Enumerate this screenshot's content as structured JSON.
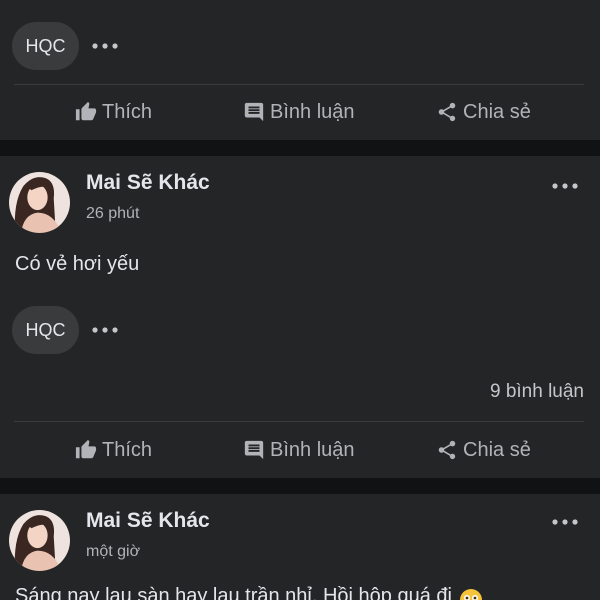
{
  "theme": {
    "page_bg": "#111214",
    "card_bg": "#242526",
    "text_primary": "#e4e6eb",
    "text_secondary": "#b0b3b8",
    "divider": "#3a3b3c",
    "badge_bg": "#3a3b3c"
  },
  "actions": {
    "like": {
      "label": "Thích",
      "icon": "thumbs-up-icon"
    },
    "comment": {
      "label": "Bình luận",
      "icon": "comment-icon"
    },
    "share": {
      "label": "Chia sẻ",
      "icon": "share-icon"
    }
  },
  "posts": [
    {
      "reaction_badge": "HQC"
    },
    {
      "author": "Mai Sẽ Khác",
      "time": "26 phút",
      "body": "Có vẻ hơi yếu",
      "reaction_badge": "HQC",
      "comment_count": "9 bình luận"
    },
    {
      "author": "Mai Sẽ Khác",
      "time": "một giờ",
      "body": "Sáng nay lau sàn hay lau trần nhỉ. Hồi hộp quá đi",
      "emoji": "flushed-face-emoji-icon"
    }
  ]
}
